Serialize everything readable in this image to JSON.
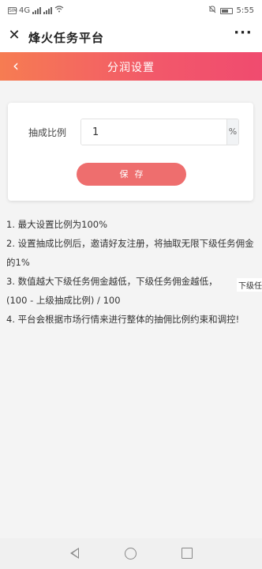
{
  "status_bar": {
    "sim1": "SIM",
    "network": "4G",
    "time": "5:55"
  },
  "title_bar": {
    "close_icon": "close-icon",
    "title": "烽火任务平台",
    "more_icon": "more-icon",
    "more_label": "···"
  },
  "header": {
    "back_icon": "chevron-left-icon",
    "back_label": "‹",
    "title": "分润设置",
    "gradient": [
      "#f67c52",
      "#f04b6f"
    ]
  },
  "form": {
    "label": "抽成比例",
    "value": "1",
    "unit": "%",
    "save_label": "保存",
    "save_color": "#ee6e6e"
  },
  "notes": [
    "1. 最大设置比例为100%",
    "2. 设置抽成比例后，邀请好友注册，将抽取无限下级任务佣金的1%",
    "3. 数值越大下级任务佣金越低，下级任务佣金越低，",
    "(100 - 上级抽成比例) / 100",
    "4. 平台会根据市场行情来进行整体的抽佣比例约束和调控!"
  ],
  "tooltip": "下级任",
  "nav_bar": {
    "back_icon": "nav-back-icon",
    "home_icon": "nav-home-icon",
    "recent_icon": "nav-recent-icon"
  }
}
